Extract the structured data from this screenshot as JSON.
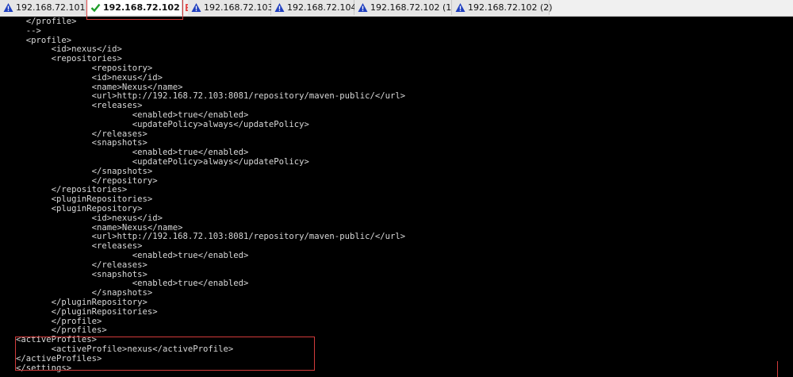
{
  "tabs": [
    {
      "label": "192.168.72.101",
      "status": "warning",
      "active": false
    },
    {
      "label": "192.168.72.102",
      "status": "connected",
      "active": true
    },
    {
      "label": "192.168.72.103",
      "status": "warning",
      "active": false
    },
    {
      "label": "192.168.72.104",
      "status": "warning",
      "active": false
    },
    {
      "label": "192.168.72.102 (1)",
      "status": "warning",
      "active": false
    },
    {
      "label": "192.168.72.102 (2)",
      "status": "warning",
      "active": false
    }
  ],
  "colors": {
    "warning": "#1f3fbf",
    "connected": "#1e9e2a",
    "highlight": "#d23b3b",
    "terminal_bg": "#000000",
    "terminal_fg": "#d8d8d8"
  },
  "terminal": {
    "lines": [
      "  </profile>",
      "  -->",
      "  <profile>",
      "       <id>nexus</id>",
      "       <repositories>",
      "               <repository>",
      "               <id>nexus</id>",
      "               <name>Nexus</name>",
      "               <url>http://192.168.72.103:8081/repository/maven-public/</url>",
      "               <releases>",
      "                       <enabled>true</enabled>",
      "                       <updatePolicy>always</updatePolicy>",
      "               </releases>",
      "               <snapshots>",
      "                       <enabled>true</enabled>",
      "                       <updatePolicy>always</updatePolicy>",
      "               </snapshots>",
      "               </repository>",
      "       </repositories>",
      "       <pluginRepositories>",
      "       <pluginRepository>",
      "               <id>nexus</id>",
      "               <name>Nexus</name>",
      "               <url>http://192.168.72.103:8081/repository/maven-public/</url>",
      "               <releases>",
      "                       <enabled>true</enabled>",
      "               </releases>",
      "               <snapshots>",
      "                       <enabled>true</enabled>",
      "               </snapshots>",
      "       </pluginRepository>",
      "       </pluginRepositories>",
      "       </profile>",
      "       </profiles>",
      "<activeProfiles>",
      "       <activeProfile>nexus</activeProfile>",
      "</activeProfiles>",
      "</settings>"
    ]
  }
}
